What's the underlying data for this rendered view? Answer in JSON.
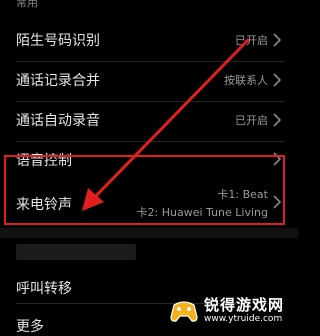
{
  "section": {
    "header": "常用"
  },
  "rows": [
    {
      "title": "陌生号码识别",
      "value": "已开启"
    },
    {
      "title": "通话记录合并",
      "value": "按联系人"
    },
    {
      "title": "通话自动录音",
      "value": "已开启"
    },
    {
      "title": "语音控制",
      "value": ""
    },
    {
      "title": "来电铃声",
      "value_line1": "卡1: Beat",
      "value_line2": "卡2: Huawei Tune Living"
    }
  ],
  "lower_rows": [
    {
      "title": "呼叫转移"
    },
    {
      "title": "更多"
    }
  ],
  "watermark": {
    "title": "锐得游戏网",
    "url": "www.ytruide.com"
  },
  "colors": {
    "background": "#000000",
    "highlight": "#e1201d",
    "arrow": "#e1201d"
  }
}
